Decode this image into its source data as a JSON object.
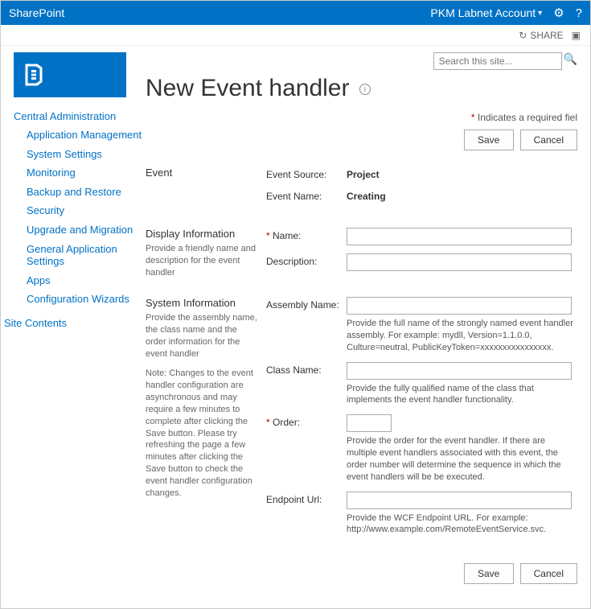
{
  "suite": {
    "brand": "SharePoint",
    "account": "PKM Labnet Account"
  },
  "ribbon": {
    "share": "SHARE"
  },
  "search": {
    "placeholder": "Search this site..."
  },
  "page": {
    "title": "New Event handler",
    "required_note": "Indicates a required fiel",
    "save": "Save",
    "cancel": "Cancel"
  },
  "nav": {
    "header": "Central Administration",
    "items": [
      "Application Management",
      "System Settings",
      "Monitoring",
      "Backup and Restore",
      "Security",
      "Upgrade and Migration",
      "General Application Settings",
      "Apps",
      "Configuration Wizards"
    ],
    "site_contents": "Site Contents"
  },
  "sections": {
    "event": {
      "title": "Event",
      "source_label": "Event Source:",
      "source_value": "Project",
      "name_label": "Event Name:",
      "name_value": "Creating"
    },
    "display": {
      "title": "Display Information",
      "desc": "Provide a friendly name and description for the event handler",
      "name_label": "Name:",
      "desc_label": "Description:"
    },
    "system": {
      "title": "System Information",
      "desc": "Provide the assembly name, the class name and the order information for the event handler",
      "note": "Note: Changes to the event handler configuration are asynchronous and may require a few minutes to complete after clicking the Save button. Please try refreshing the page a few minutes after clicking the Save button to check the event handler configuration changes.",
      "assembly_label": "Assembly Name:",
      "assembly_help": "Provide the full name of the strongly named event handler assembly. For example: mydll, Version=1.1.0.0, Culture=neutral, PublicKeyToken=xxxxxxxxxxxxxxxx.",
      "class_label": "Class Name:",
      "class_help": "Provide the fully qualified name of the class that implements the event handler functionality.",
      "order_label": "Order:",
      "order_help": "Provide the order for the event handler. If there are multiple event handlers associated with this event, the order number will determine the sequence in which the event handlers will be be executed.",
      "endpoint_label": "Endpoint Url:",
      "endpoint_help": "Provide the WCF Endpoint URL. For example: http://www.example.com/RemoteEventService.svc."
    }
  }
}
